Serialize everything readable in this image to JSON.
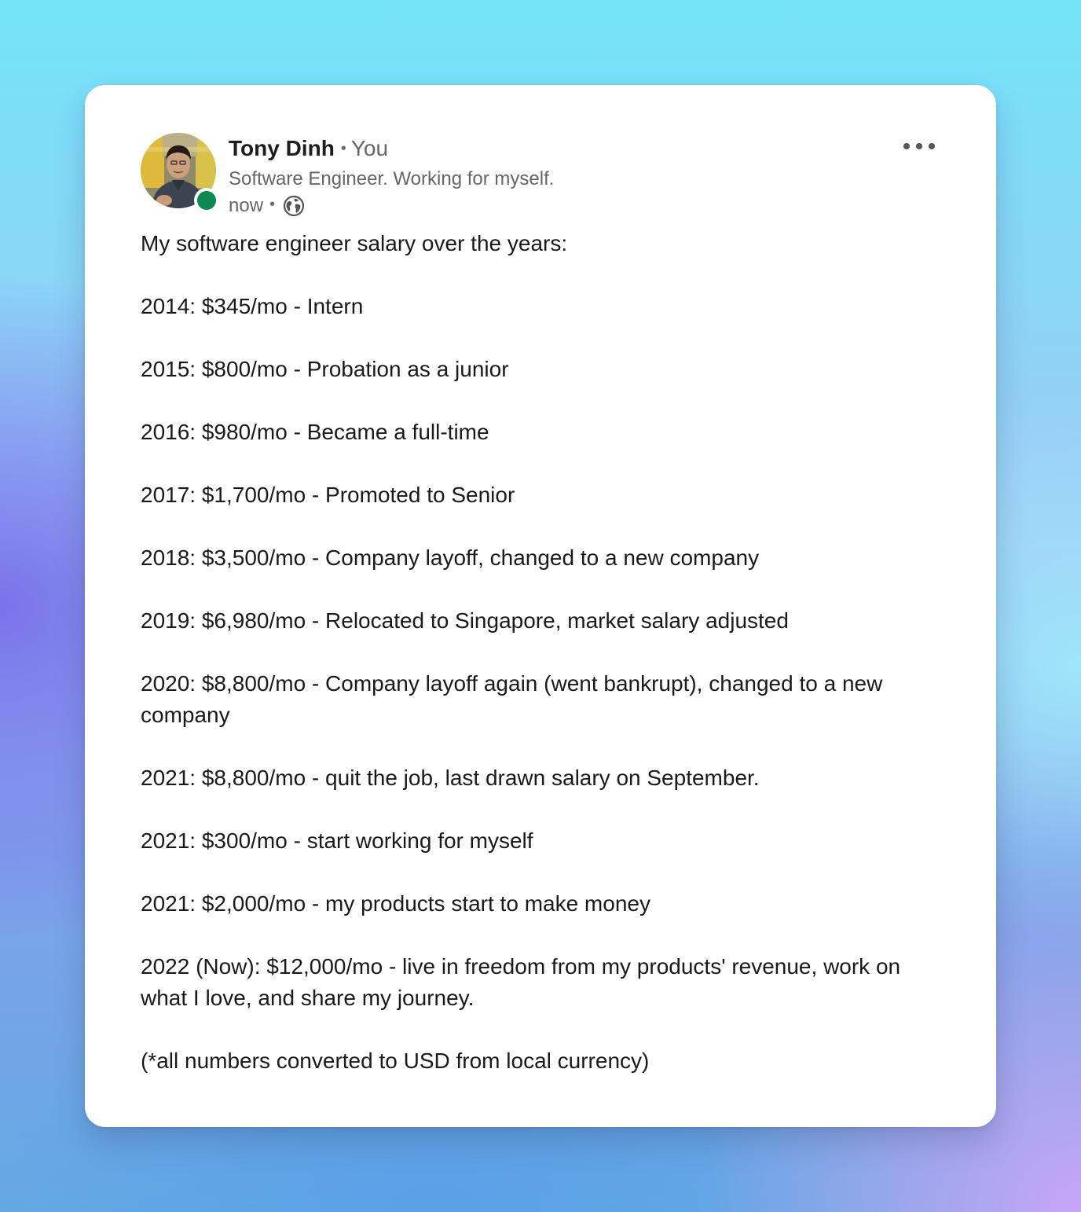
{
  "post": {
    "author": {
      "name": "Tony Dinh",
      "relation": "You",
      "headline": "Software Engineer. Working for myself.",
      "timestamp": "now",
      "visibility_icon": "globe-icon",
      "presence_color": "#0a8a4f"
    },
    "menu_icon": "more-horizontal-icon",
    "body": {
      "intro": "My software engineer salary over the years:",
      "entries": [
        "2014: $345/mo - Intern",
        "2015: $800/mo - Probation as a junior",
        "2016: $980/mo - Became a full-time",
        "2017: $1,700/mo - Promoted to Senior",
        "2018: $3,500/mo - Company layoff, changed to a new company",
        "2019: $6,980/mo - Relocated to Singapore, market salary adjusted",
        "2020: $8,800/mo - Company layoff again (went bankrupt), changed to a new company",
        "2021: $8,800/mo - quit the job, last drawn salary on September.",
        "2021: $300/mo - start working for myself",
        "2021: $2,000/mo - my products start to make money",
        "2022 (Now): $12,000/mo - live in freedom from my products' revenue, work on what I love, and share my journey."
      ],
      "footnote": "(*all numbers converted to USD from local currency)"
    }
  }
}
